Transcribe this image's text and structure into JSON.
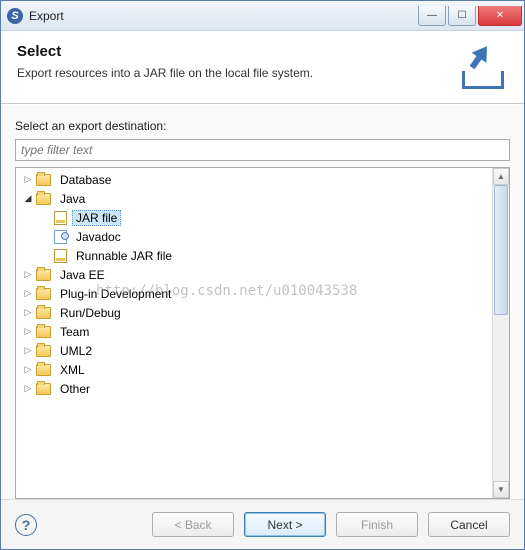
{
  "window": {
    "title": "Export"
  },
  "header": {
    "heading": "Select",
    "description": "Export resources into a JAR file on the local file system."
  },
  "content": {
    "label": "Select an export destination:",
    "filter_placeholder": "type filter text"
  },
  "tree": {
    "nodes": [
      {
        "label": "Database",
        "depth": 0,
        "expanded": false,
        "icon": "folder",
        "selected": false
      },
      {
        "label": "Java",
        "depth": 0,
        "expanded": true,
        "icon": "folder",
        "selected": false
      },
      {
        "label": "JAR file",
        "depth": 1,
        "expanded": null,
        "icon": "jar",
        "selected": true
      },
      {
        "label": "Javadoc",
        "depth": 1,
        "expanded": null,
        "icon": "doc",
        "selected": false
      },
      {
        "label": "Runnable JAR file",
        "depth": 1,
        "expanded": null,
        "icon": "jar",
        "selected": false
      },
      {
        "label": "Java EE",
        "depth": 0,
        "expanded": false,
        "icon": "folder",
        "selected": false
      },
      {
        "label": "Plug-in Development",
        "depth": 0,
        "expanded": false,
        "icon": "folder",
        "selected": false
      },
      {
        "label": "Run/Debug",
        "depth": 0,
        "expanded": false,
        "icon": "folder",
        "selected": false
      },
      {
        "label": "Team",
        "depth": 0,
        "expanded": false,
        "icon": "folder",
        "selected": false
      },
      {
        "label": "UML2",
        "depth": 0,
        "expanded": false,
        "icon": "folder",
        "selected": false
      },
      {
        "label": "XML",
        "depth": 0,
        "expanded": false,
        "icon": "folder",
        "selected": false
      },
      {
        "label": "Other",
        "depth": 0,
        "expanded": false,
        "icon": "folder",
        "selected": false
      }
    ]
  },
  "buttons": {
    "back": "< Back",
    "next": "Next >",
    "finish": "Finish",
    "cancel": "Cancel"
  },
  "watermark": "http://blog.csdn.net/u010043538"
}
